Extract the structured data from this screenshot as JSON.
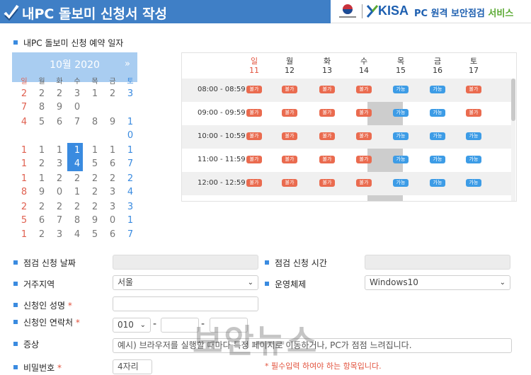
{
  "header": {
    "title": "내PC 돌보미 신청서 작성",
    "brand_name": "KISA",
    "service_main": "PC 원격 보안점검 ",
    "service_accent": "서비스"
  },
  "colors": {
    "header_bg": "#3f7fc6",
    "not_available": "#ea6b4f",
    "available": "#3d9ce6",
    "required": "#e2533e"
  },
  "reservation": {
    "section_title": "내PC 돌보미 신청 예약 일자",
    "calendar": {
      "month_label": "10월 2020",
      "next_icon": "»",
      "weekdays": [
        "일",
        "월",
        "화",
        "수",
        "목",
        "금",
        "토"
      ],
      "rows": [
        [
          "2",
          "2",
          "2",
          "3",
          "1",
          "2",
          "3"
        ],
        [
          "7",
          "8",
          "9",
          "0",
          "",
          "",
          ""
        ],
        [
          "4",
          "5",
          "6",
          "7",
          "8",
          "9",
          "1"
        ],
        [
          "",
          "",
          "",
          "",
          "",
          "",
          "0"
        ],
        [
          "1",
          "1",
          "1",
          "1",
          "1",
          "1",
          "1"
        ],
        [
          "1",
          "2",
          "3",
          "4",
          "5",
          "6",
          "7"
        ],
        [
          "1",
          "1",
          "2",
          "2",
          "2",
          "2",
          "2"
        ],
        [
          "8",
          "9",
          "0",
          "1",
          "2",
          "3",
          "4"
        ],
        [
          "2",
          "2",
          "2",
          "2",
          "2",
          "3",
          "3"
        ],
        [
          "5",
          "6",
          "7",
          "8",
          "9",
          "0",
          "1"
        ],
        [
          "1",
          "2",
          "3",
          "4",
          "5",
          "6",
          "7"
        ]
      ]
    },
    "week": [
      {
        "dow": "일",
        "date": "11"
      },
      {
        "dow": "월",
        "date": "12"
      },
      {
        "dow": "화",
        "date": "13"
      },
      {
        "dow": "수",
        "date": "14"
      },
      {
        "dow": "목",
        "date": "15"
      },
      {
        "dow": "금",
        "date": "16"
      },
      {
        "dow": "토",
        "date": "17"
      }
    ],
    "slots": [
      {
        "time": "08:00 - 08:59",
        "status": [
          "불가",
          "불가",
          "불가",
          "불가",
          "가능",
          "가능",
          "불가"
        ]
      },
      {
        "time": "09:00 - 09:59",
        "status": [
          "불가",
          "불가",
          "불가",
          "불가",
          "가능",
          "가능",
          "불가"
        ]
      },
      {
        "time": "10:00 - 10:59",
        "status": [
          "불가",
          "불가",
          "불가",
          "불가",
          "가능",
          "가능",
          "가능"
        ]
      },
      {
        "time": "11:00 - 11:59",
        "status": [
          "불가",
          "불가",
          "불가",
          "불가",
          "가능",
          "가능",
          "가능"
        ]
      },
      {
        "time": "12:00 - 12:59",
        "status": [
          "불가",
          "불가",
          "불가",
          "불가",
          "가능",
          "가능",
          "가능"
        ]
      }
    ]
  },
  "form": {
    "inspect_date_label": "점검 신청 날짜",
    "inspect_time_label": "점검 신청 시간",
    "region_label": "거주지역",
    "region_value": "서울",
    "os_label": "운영체제",
    "os_value": "Windows10",
    "name_label": "신청인 성명",
    "contact_label": "신청인 연락처",
    "phone_prefix": "010",
    "phone_sep": "-",
    "symptom_label": "증상",
    "symptom_placeholder": "예시) 브라우저를 실행할 때마다 특정 페이지로 이동하거나, PC가 점점 느려집니다.",
    "password_label": "비밀번호",
    "password_placeholder": "4자리",
    "required_mark": "*",
    "required_hint": "* 필수입력 하여야 하는 항목입니다."
  },
  "watermark": "보안뉴스"
}
